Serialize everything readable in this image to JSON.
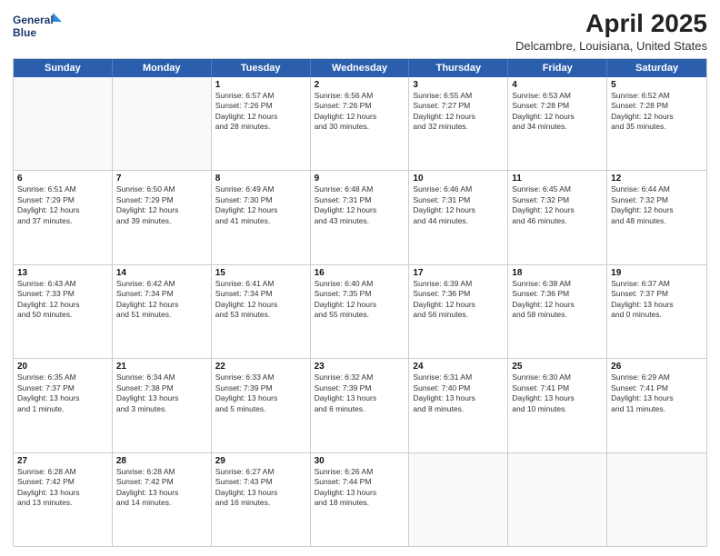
{
  "logo": {
    "line1": "General",
    "line2": "Blue"
  },
  "title": "April 2025",
  "subtitle": "Delcambre, Louisiana, United States",
  "days": [
    "Sunday",
    "Monday",
    "Tuesday",
    "Wednesday",
    "Thursday",
    "Friday",
    "Saturday"
  ],
  "weeks": [
    [
      {
        "day": "",
        "info": ""
      },
      {
        "day": "",
        "info": ""
      },
      {
        "day": "1",
        "info": "Sunrise: 6:57 AM\nSunset: 7:26 PM\nDaylight: 12 hours\nand 28 minutes."
      },
      {
        "day": "2",
        "info": "Sunrise: 6:56 AM\nSunset: 7:26 PM\nDaylight: 12 hours\nand 30 minutes."
      },
      {
        "day": "3",
        "info": "Sunrise: 6:55 AM\nSunset: 7:27 PM\nDaylight: 12 hours\nand 32 minutes."
      },
      {
        "day": "4",
        "info": "Sunrise: 6:53 AM\nSunset: 7:28 PM\nDaylight: 12 hours\nand 34 minutes."
      },
      {
        "day": "5",
        "info": "Sunrise: 6:52 AM\nSunset: 7:28 PM\nDaylight: 12 hours\nand 35 minutes."
      }
    ],
    [
      {
        "day": "6",
        "info": "Sunrise: 6:51 AM\nSunset: 7:29 PM\nDaylight: 12 hours\nand 37 minutes."
      },
      {
        "day": "7",
        "info": "Sunrise: 6:50 AM\nSunset: 7:29 PM\nDaylight: 12 hours\nand 39 minutes."
      },
      {
        "day": "8",
        "info": "Sunrise: 6:49 AM\nSunset: 7:30 PM\nDaylight: 12 hours\nand 41 minutes."
      },
      {
        "day": "9",
        "info": "Sunrise: 6:48 AM\nSunset: 7:31 PM\nDaylight: 12 hours\nand 43 minutes."
      },
      {
        "day": "10",
        "info": "Sunrise: 6:46 AM\nSunset: 7:31 PM\nDaylight: 12 hours\nand 44 minutes."
      },
      {
        "day": "11",
        "info": "Sunrise: 6:45 AM\nSunset: 7:32 PM\nDaylight: 12 hours\nand 46 minutes."
      },
      {
        "day": "12",
        "info": "Sunrise: 6:44 AM\nSunset: 7:32 PM\nDaylight: 12 hours\nand 48 minutes."
      }
    ],
    [
      {
        "day": "13",
        "info": "Sunrise: 6:43 AM\nSunset: 7:33 PM\nDaylight: 12 hours\nand 50 minutes."
      },
      {
        "day": "14",
        "info": "Sunrise: 6:42 AM\nSunset: 7:34 PM\nDaylight: 12 hours\nand 51 minutes."
      },
      {
        "day": "15",
        "info": "Sunrise: 6:41 AM\nSunset: 7:34 PM\nDaylight: 12 hours\nand 53 minutes."
      },
      {
        "day": "16",
        "info": "Sunrise: 6:40 AM\nSunset: 7:35 PM\nDaylight: 12 hours\nand 55 minutes."
      },
      {
        "day": "17",
        "info": "Sunrise: 6:39 AM\nSunset: 7:36 PM\nDaylight: 12 hours\nand 56 minutes."
      },
      {
        "day": "18",
        "info": "Sunrise: 6:38 AM\nSunset: 7:36 PM\nDaylight: 12 hours\nand 58 minutes."
      },
      {
        "day": "19",
        "info": "Sunrise: 6:37 AM\nSunset: 7:37 PM\nDaylight: 13 hours\nand 0 minutes."
      }
    ],
    [
      {
        "day": "20",
        "info": "Sunrise: 6:35 AM\nSunset: 7:37 PM\nDaylight: 13 hours\nand 1 minute."
      },
      {
        "day": "21",
        "info": "Sunrise: 6:34 AM\nSunset: 7:38 PM\nDaylight: 13 hours\nand 3 minutes."
      },
      {
        "day": "22",
        "info": "Sunrise: 6:33 AM\nSunset: 7:39 PM\nDaylight: 13 hours\nand 5 minutes."
      },
      {
        "day": "23",
        "info": "Sunrise: 6:32 AM\nSunset: 7:39 PM\nDaylight: 13 hours\nand 6 minutes."
      },
      {
        "day": "24",
        "info": "Sunrise: 6:31 AM\nSunset: 7:40 PM\nDaylight: 13 hours\nand 8 minutes."
      },
      {
        "day": "25",
        "info": "Sunrise: 6:30 AM\nSunset: 7:41 PM\nDaylight: 13 hours\nand 10 minutes."
      },
      {
        "day": "26",
        "info": "Sunrise: 6:29 AM\nSunset: 7:41 PM\nDaylight: 13 hours\nand 11 minutes."
      }
    ],
    [
      {
        "day": "27",
        "info": "Sunrise: 6:28 AM\nSunset: 7:42 PM\nDaylight: 13 hours\nand 13 minutes."
      },
      {
        "day": "28",
        "info": "Sunrise: 6:28 AM\nSunset: 7:42 PM\nDaylight: 13 hours\nand 14 minutes."
      },
      {
        "day": "29",
        "info": "Sunrise: 6:27 AM\nSunset: 7:43 PM\nDaylight: 13 hours\nand 16 minutes."
      },
      {
        "day": "30",
        "info": "Sunrise: 6:26 AM\nSunset: 7:44 PM\nDaylight: 13 hours\nand 18 minutes."
      },
      {
        "day": "",
        "info": ""
      },
      {
        "day": "",
        "info": ""
      },
      {
        "day": "",
        "info": ""
      }
    ]
  ]
}
